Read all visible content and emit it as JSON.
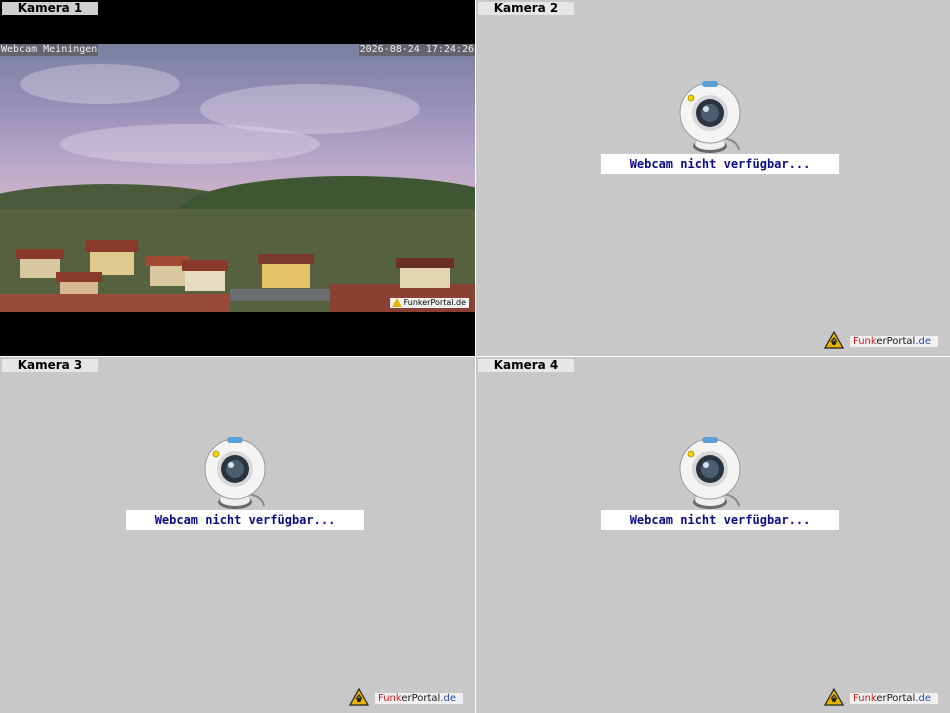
{
  "panels": [
    {
      "label": "Kamera 1"
    },
    {
      "label": "Kamera 2"
    },
    {
      "label": "Kamera 3"
    },
    {
      "label": "Kamera 4"
    }
  ],
  "live": {
    "overlay_location": "Webcam Meiningen",
    "overlay_timestamp": "2026-08-24 17:24:26",
    "brand": "FunkerPortal.de"
  },
  "unavailable_message": "Webcam nicht verfügbar...",
  "brand": {
    "part1": "Funk",
    "part2": "erPortal",
    "part3": ".de"
  },
  "colors": {
    "panel_bg": "#c8c8c8",
    "message_text": "#0b0b8a",
    "logo_yellow": "#e7b400"
  },
  "icons": [
    "webcam-icon",
    "warning-logo-icon"
  ]
}
